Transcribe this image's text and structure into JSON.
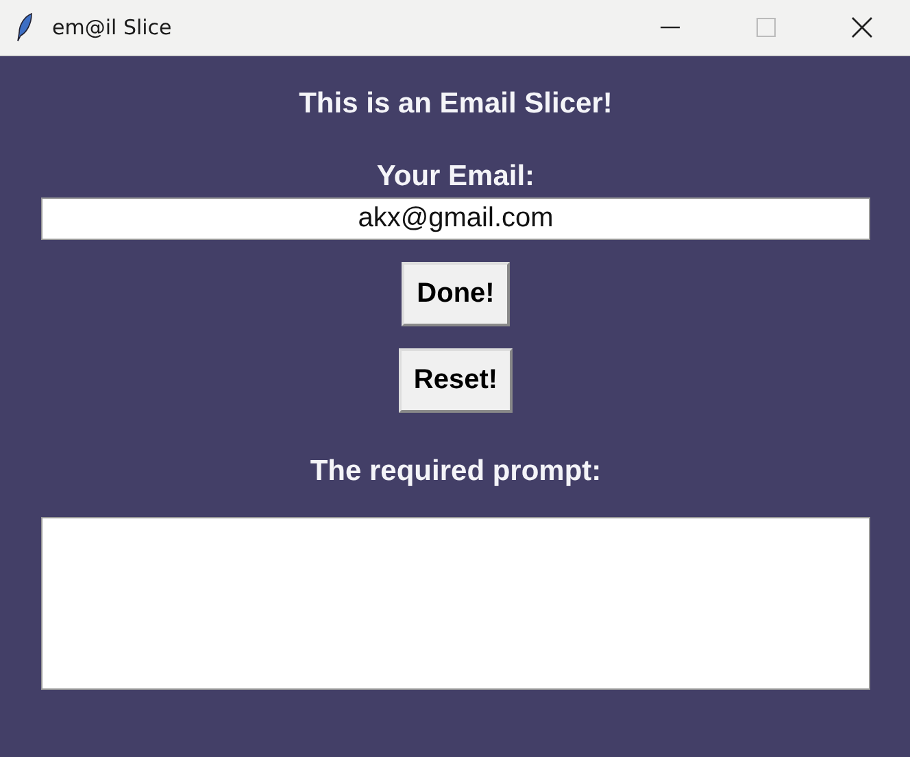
{
  "window": {
    "title": "em@il Slice"
  },
  "heading": "This is an Email Slicer!",
  "email_label": "Your Email:",
  "email_field": {
    "value": "akx@gmail.com"
  },
  "buttons": [
    "Done!",
    "Reset!"
  ],
  "prompt_label": "The required prompt:"
}
